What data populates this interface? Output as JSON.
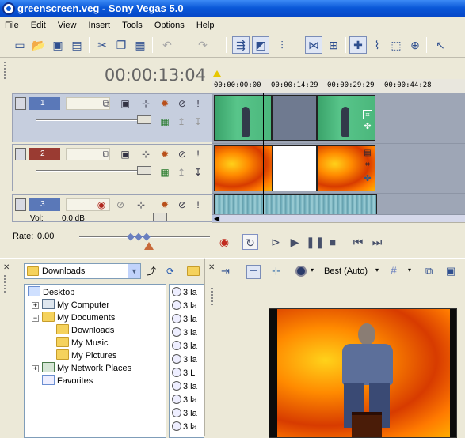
{
  "window": {
    "title": "greenscreen.veg - Sony Vegas 5.0"
  },
  "menu": [
    "File",
    "Edit",
    "View",
    "Insert",
    "Tools",
    "Options",
    "Help"
  ],
  "timecode": "00:00:13:04",
  "ruler": {
    "labels": [
      "00:00:00:00",
      "00:00:14:29",
      "00:00:29:29",
      "00:00:44:28"
    ]
  },
  "tracks": [
    {
      "number": "1",
      "type": "video"
    },
    {
      "number": "2",
      "type": "video"
    },
    {
      "number": "3",
      "type": "audio",
      "volume_label": "Vol:",
      "volume_value": "0.0 dB"
    }
  ],
  "rate": {
    "label": "Rate:",
    "value": "0.00"
  },
  "explorer": {
    "location": "Downloads",
    "tree": [
      "Desktop",
      "My Computer",
      "My Documents",
      "Downloads",
      "My Music",
      "My Pictures",
      "My Network Places",
      "Favorites"
    ],
    "files": [
      "3 la",
      "3 la",
      "3 la",
      "3 la",
      "3 la",
      "3 la",
      "3 L",
      "3 la",
      "3 la",
      "3 la",
      "3 la"
    ]
  },
  "preview": {
    "quality": "Best (Auto)"
  },
  "colors": {
    "titlebar": "#0a58d8",
    "track1": "#5a78b8",
    "track2": "#9a3b32",
    "track3": "#5a78b8"
  }
}
